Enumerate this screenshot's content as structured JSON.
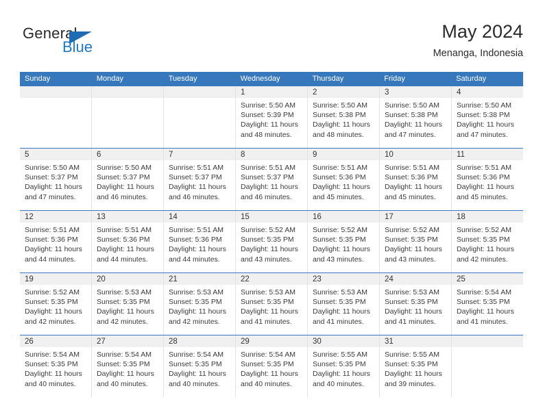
{
  "brand": {
    "name_part1": "General",
    "name_part2": "Blue",
    "triangle_color": "#1f6cb4",
    "blue_color": "#1f7ac4"
  },
  "header": {
    "title": "May 2024",
    "subtitle": "Menanga, Indonesia"
  },
  "theme": {
    "header_blue": "#3778bd",
    "day_strip_gray": "#f0f0f0",
    "cell_border": "#e2e2e2"
  },
  "weekdays": [
    "Sunday",
    "Monday",
    "Tuesday",
    "Wednesday",
    "Thursday",
    "Friday",
    "Saturday"
  ],
  "weeks": [
    [
      {
        "day": "",
        "sunrise": "",
        "sunset": "",
        "daylight1": "",
        "daylight2": ""
      },
      {
        "day": "",
        "sunrise": "",
        "sunset": "",
        "daylight1": "",
        "daylight2": ""
      },
      {
        "day": "",
        "sunrise": "",
        "sunset": "",
        "daylight1": "",
        "daylight2": ""
      },
      {
        "day": "1",
        "sunrise": "Sunrise: 5:50 AM",
        "sunset": "Sunset: 5:39 PM",
        "daylight1": "Daylight: 11 hours",
        "daylight2": "and 48 minutes."
      },
      {
        "day": "2",
        "sunrise": "Sunrise: 5:50 AM",
        "sunset": "Sunset: 5:38 PM",
        "daylight1": "Daylight: 11 hours",
        "daylight2": "and 48 minutes."
      },
      {
        "day": "3",
        "sunrise": "Sunrise: 5:50 AM",
        "sunset": "Sunset: 5:38 PM",
        "daylight1": "Daylight: 11 hours",
        "daylight2": "and 47 minutes."
      },
      {
        "day": "4",
        "sunrise": "Sunrise: 5:50 AM",
        "sunset": "Sunset: 5:38 PM",
        "daylight1": "Daylight: 11 hours",
        "daylight2": "and 47 minutes."
      }
    ],
    [
      {
        "day": "5",
        "sunrise": "Sunrise: 5:50 AM",
        "sunset": "Sunset: 5:37 PM",
        "daylight1": "Daylight: 11 hours",
        "daylight2": "and 47 minutes."
      },
      {
        "day": "6",
        "sunrise": "Sunrise: 5:50 AM",
        "sunset": "Sunset: 5:37 PM",
        "daylight1": "Daylight: 11 hours",
        "daylight2": "and 46 minutes."
      },
      {
        "day": "7",
        "sunrise": "Sunrise: 5:51 AM",
        "sunset": "Sunset: 5:37 PM",
        "daylight1": "Daylight: 11 hours",
        "daylight2": "and 46 minutes."
      },
      {
        "day": "8",
        "sunrise": "Sunrise: 5:51 AM",
        "sunset": "Sunset: 5:37 PM",
        "daylight1": "Daylight: 11 hours",
        "daylight2": "and 46 minutes."
      },
      {
        "day": "9",
        "sunrise": "Sunrise: 5:51 AM",
        "sunset": "Sunset: 5:36 PM",
        "daylight1": "Daylight: 11 hours",
        "daylight2": "and 45 minutes."
      },
      {
        "day": "10",
        "sunrise": "Sunrise: 5:51 AM",
        "sunset": "Sunset: 5:36 PM",
        "daylight1": "Daylight: 11 hours",
        "daylight2": "and 45 minutes."
      },
      {
        "day": "11",
        "sunrise": "Sunrise: 5:51 AM",
        "sunset": "Sunset: 5:36 PM",
        "daylight1": "Daylight: 11 hours",
        "daylight2": "and 45 minutes."
      }
    ],
    [
      {
        "day": "12",
        "sunrise": "Sunrise: 5:51 AM",
        "sunset": "Sunset: 5:36 PM",
        "daylight1": "Daylight: 11 hours",
        "daylight2": "and 44 minutes."
      },
      {
        "day": "13",
        "sunrise": "Sunrise: 5:51 AM",
        "sunset": "Sunset: 5:36 PM",
        "daylight1": "Daylight: 11 hours",
        "daylight2": "and 44 minutes."
      },
      {
        "day": "14",
        "sunrise": "Sunrise: 5:51 AM",
        "sunset": "Sunset: 5:36 PM",
        "daylight1": "Daylight: 11 hours",
        "daylight2": "and 44 minutes."
      },
      {
        "day": "15",
        "sunrise": "Sunrise: 5:52 AM",
        "sunset": "Sunset: 5:35 PM",
        "daylight1": "Daylight: 11 hours",
        "daylight2": "and 43 minutes."
      },
      {
        "day": "16",
        "sunrise": "Sunrise: 5:52 AM",
        "sunset": "Sunset: 5:35 PM",
        "daylight1": "Daylight: 11 hours",
        "daylight2": "and 43 minutes."
      },
      {
        "day": "17",
        "sunrise": "Sunrise: 5:52 AM",
        "sunset": "Sunset: 5:35 PM",
        "daylight1": "Daylight: 11 hours",
        "daylight2": "and 43 minutes."
      },
      {
        "day": "18",
        "sunrise": "Sunrise: 5:52 AM",
        "sunset": "Sunset: 5:35 PM",
        "daylight1": "Daylight: 11 hours",
        "daylight2": "and 42 minutes."
      }
    ],
    [
      {
        "day": "19",
        "sunrise": "Sunrise: 5:52 AM",
        "sunset": "Sunset: 5:35 PM",
        "daylight1": "Daylight: 11 hours",
        "daylight2": "and 42 minutes."
      },
      {
        "day": "20",
        "sunrise": "Sunrise: 5:53 AM",
        "sunset": "Sunset: 5:35 PM",
        "daylight1": "Daylight: 11 hours",
        "daylight2": "and 42 minutes."
      },
      {
        "day": "21",
        "sunrise": "Sunrise: 5:53 AM",
        "sunset": "Sunset: 5:35 PM",
        "daylight1": "Daylight: 11 hours",
        "daylight2": "and 42 minutes."
      },
      {
        "day": "22",
        "sunrise": "Sunrise: 5:53 AM",
        "sunset": "Sunset: 5:35 PM",
        "daylight1": "Daylight: 11 hours",
        "daylight2": "and 41 minutes."
      },
      {
        "day": "23",
        "sunrise": "Sunrise: 5:53 AM",
        "sunset": "Sunset: 5:35 PM",
        "daylight1": "Daylight: 11 hours",
        "daylight2": "and 41 minutes."
      },
      {
        "day": "24",
        "sunrise": "Sunrise: 5:53 AM",
        "sunset": "Sunset: 5:35 PM",
        "daylight1": "Daylight: 11 hours",
        "daylight2": "and 41 minutes."
      },
      {
        "day": "25",
        "sunrise": "Sunrise: 5:54 AM",
        "sunset": "Sunset: 5:35 PM",
        "daylight1": "Daylight: 11 hours",
        "daylight2": "and 41 minutes."
      }
    ],
    [
      {
        "day": "26",
        "sunrise": "Sunrise: 5:54 AM",
        "sunset": "Sunset: 5:35 PM",
        "daylight1": "Daylight: 11 hours",
        "daylight2": "and 40 minutes."
      },
      {
        "day": "27",
        "sunrise": "Sunrise: 5:54 AM",
        "sunset": "Sunset: 5:35 PM",
        "daylight1": "Daylight: 11 hours",
        "daylight2": "and 40 minutes."
      },
      {
        "day": "28",
        "sunrise": "Sunrise: 5:54 AM",
        "sunset": "Sunset: 5:35 PM",
        "daylight1": "Daylight: 11 hours",
        "daylight2": "and 40 minutes."
      },
      {
        "day": "29",
        "sunrise": "Sunrise: 5:54 AM",
        "sunset": "Sunset: 5:35 PM",
        "daylight1": "Daylight: 11 hours",
        "daylight2": "and 40 minutes."
      },
      {
        "day": "30",
        "sunrise": "Sunrise: 5:55 AM",
        "sunset": "Sunset: 5:35 PM",
        "daylight1": "Daylight: 11 hours",
        "daylight2": "and 40 minutes."
      },
      {
        "day": "31",
        "sunrise": "Sunrise: 5:55 AM",
        "sunset": "Sunset: 5:35 PM",
        "daylight1": "Daylight: 11 hours",
        "daylight2": "and 39 minutes."
      },
      {
        "day": "",
        "sunrise": "",
        "sunset": "",
        "daylight1": "",
        "daylight2": ""
      }
    ]
  ]
}
